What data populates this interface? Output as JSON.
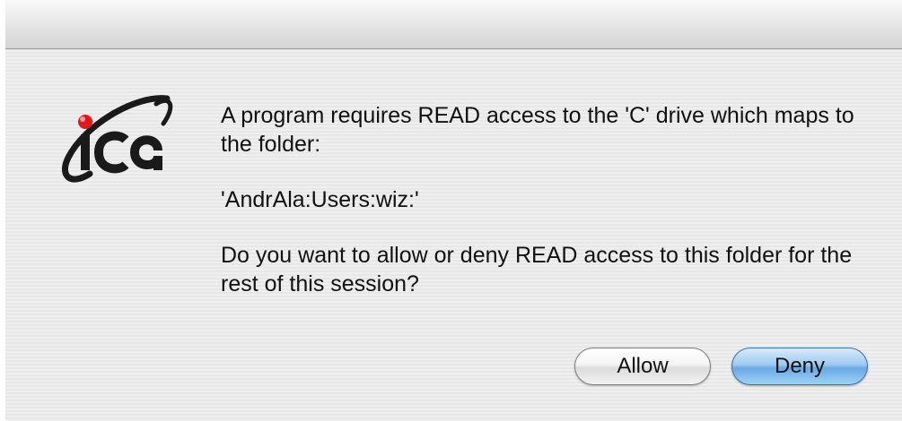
{
  "dialog": {
    "logo_text": "ica",
    "message_line1": "A program requires READ access to the 'C' drive which maps to the folder:",
    "folder_path": "'AndrAla:Users:wiz:'",
    "question": "Do you want to allow or deny READ access to this folder for the rest of this session?",
    "allow_label": "Allow",
    "deny_label": "Deny",
    "default_button": "Deny"
  },
  "colors": {
    "logo_dot": "#e01818",
    "default_button": "#6aa9e3"
  }
}
